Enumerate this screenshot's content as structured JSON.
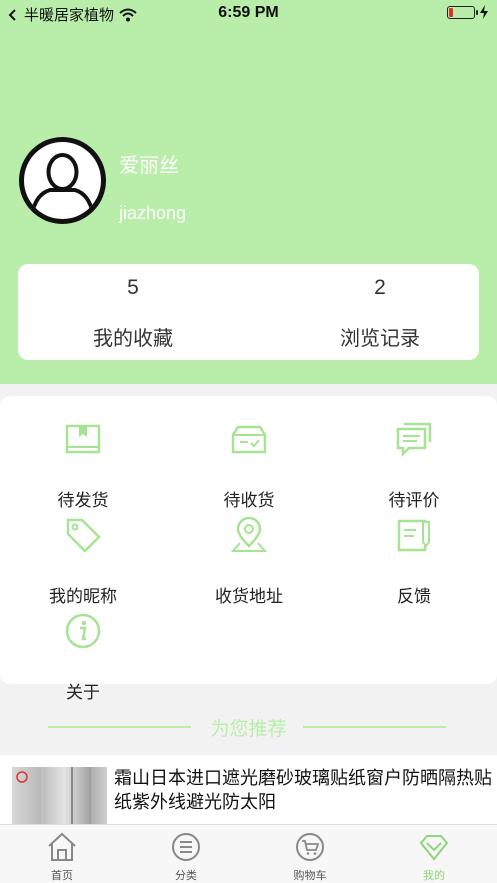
{
  "status_bar": {
    "carrier": "半暖居家植物",
    "time": "6:59 PM",
    "battery_level": 0.15,
    "battery_color": "#e0312b"
  },
  "theme": {
    "accent": "#b8eea9",
    "accent_dark": "#8fd57e"
  },
  "profile": {
    "name": "爱丽丝",
    "username": "jiazhong",
    "avatar_icon": "user-silhouette-icon"
  },
  "stats": [
    {
      "count": "5",
      "label": "我的收藏"
    },
    {
      "count": "2",
      "label": "浏览记录"
    }
  ],
  "menu": [
    {
      "label": "待发货",
      "icon": "box-icon"
    },
    {
      "label": "待收货",
      "icon": "inbox-check-icon"
    },
    {
      "label": "待评价",
      "icon": "comment-icon"
    },
    {
      "label": "我的昵称",
      "icon": "tag-icon"
    },
    {
      "label": "收货地址",
      "icon": "location-pin-icon"
    },
    {
      "label": "反馈",
      "icon": "feedback-edit-icon"
    },
    {
      "label": "关于",
      "icon": "info-icon"
    }
  ],
  "recommend_title": "为您推荐",
  "product": {
    "title": "霜山日本进口遮光磨砂玻璃贴纸窗户防晒隔热贴纸紫外线避光防太阳"
  },
  "tabbar": [
    {
      "label": "首页",
      "icon": "home-icon",
      "active": false
    },
    {
      "label": "分类",
      "icon": "list-icon",
      "active": false
    },
    {
      "label": "购物车",
      "icon": "cart-icon",
      "active": false
    },
    {
      "label": "我的",
      "icon": "diamond-icon",
      "active": true
    }
  ]
}
